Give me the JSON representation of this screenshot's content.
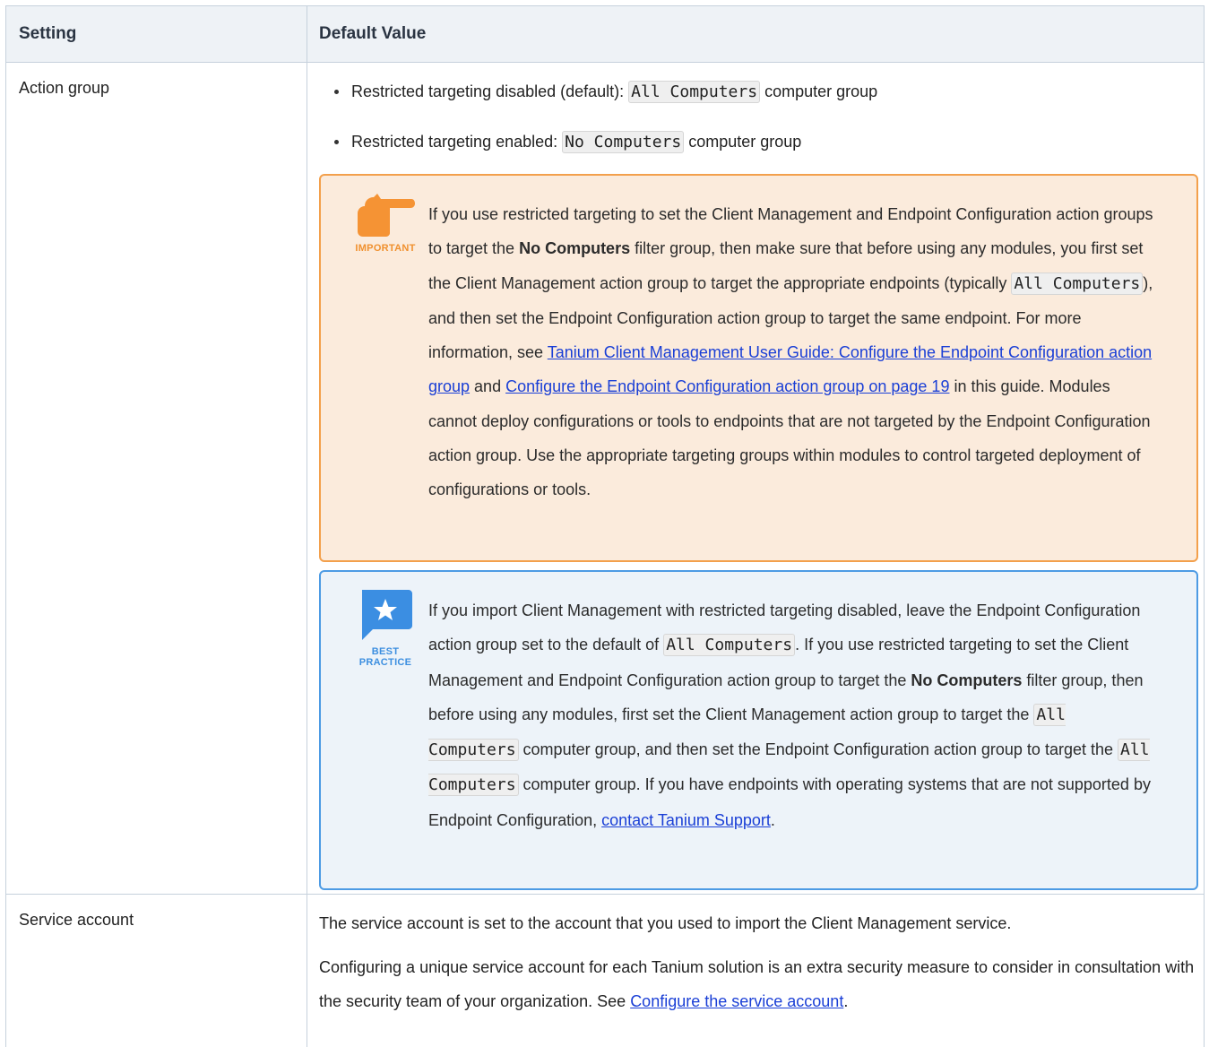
{
  "table": {
    "header": {
      "setting": "Setting",
      "default_value": "Default Value"
    },
    "rows": [
      {
        "setting": "Action group",
        "bullets": [
          {
            "prefix": "Restricted targeting disabled (default): ",
            "code": "All Computers",
            "suffix": " computer group"
          },
          {
            "prefix": "Restricted targeting enabled: ",
            "code": "No Computers",
            "suffix": " computer group"
          }
        ],
        "important": {
          "label": "IMPORTANT",
          "icon": "pointing-hand-icon",
          "color": "#f0902e",
          "t1": "If you use restricted targeting to set the Client Management and Endpoint Configuration action groups to target the ",
          "b1": "No Computers",
          "t2": " filter group, then make sure that before using any modules, you first set the Client Management action group to target the appropriate endpoints (typically ",
          "code1": "All Computers",
          "t3": "), and then set the Endpoint Configuration action group to target the same endpoint. For more information, see ",
          "link1": "Tanium Client Management User Guide: Configure the Endpoint Configuration action group",
          "t4": " and ",
          "link2": "Configure the Endpoint Configuration action group on page 19",
          "t5": " in this guide. Modules cannot deploy configurations or tools to endpoints that are not targeted by the Endpoint Configuration action group. Use the appropriate targeting groups within modules to control targeted deployment of configurations or tools."
        },
        "best_practice": {
          "label": "BEST PRACTICE",
          "icon": "star-speech-bubble-icon",
          "color": "#3d8fe0",
          "t1": "If you import Client Management with restricted targeting disabled, leave the Endpoint Configuration action group set to the default of ",
          "code1": "All Computers",
          "t2": ". If you use restricted targeting to set the Client Management and Endpoint Configuration action group to target the ",
          "b1": "No Computers",
          "t3": " filter group, then before using any modules, first set the Client Management action group to target the ",
          "code2": "All Computers",
          "t4": " computer group, and then set the Endpoint Configuration action group to target the ",
          "code3": "All Computers",
          "t5": " computer group. If you have endpoints with operating systems that are not supported by Endpoint Configuration, ",
          "link1": "contact Tanium Support",
          "t6": "."
        }
      },
      {
        "setting": "Service account",
        "p1": "The service account is set to the account that you used to import the Client Management service.",
        "p2_text": "Configuring a unique service account for each Tanium solution is an extra security measure to consider in consultation with the security team of your organization. See ",
        "p2_link": "Configure the service account",
        "p2_end": "."
      }
    ]
  }
}
